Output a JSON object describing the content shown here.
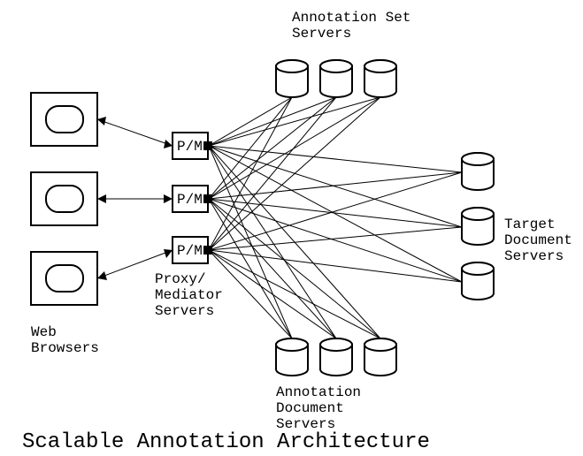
{
  "title": "Scalable Annotation Architecture",
  "labels": {
    "annotation_set_servers_l1": "Annotation Set",
    "annotation_set_servers_l2": "Servers",
    "target_document_servers_l1": "Target",
    "target_document_servers_l2": "Document",
    "target_document_servers_l3": "Servers",
    "annotation_document_servers_l1": "Annotation",
    "annotation_document_servers_l2": "Document",
    "annotation_document_servers_l3": "Servers",
    "proxy_mediator_l1": "Proxy/",
    "proxy_mediator_l2": "Mediator",
    "proxy_mediator_l3": "Servers",
    "web_browsers_l1": "Web",
    "web_browsers_l2": "Browsers",
    "pm": "P/M"
  }
}
